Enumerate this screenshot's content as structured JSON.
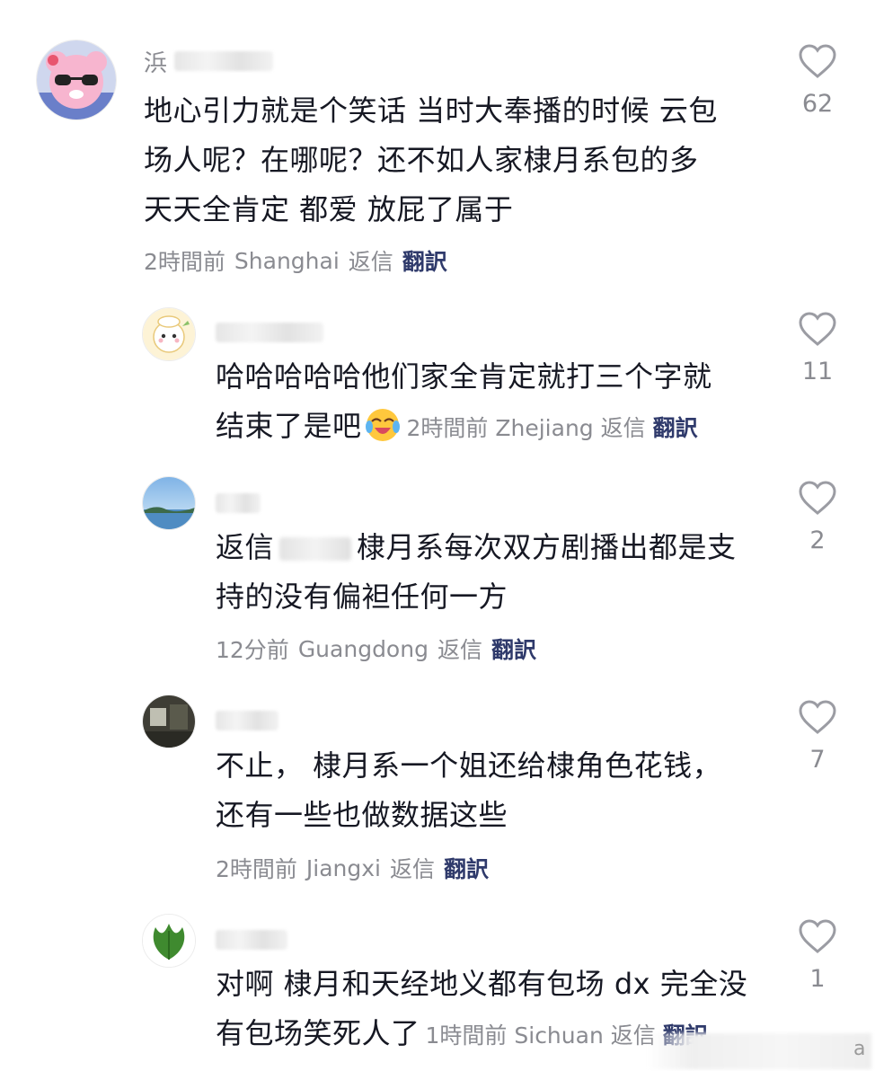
{
  "comments": [
    {
      "username": "浜",
      "text_lines": [
        "地心引力就是个笑话 当时大奉播的时候 云包",
        "场人呢？在哪呢？还不如人家棣月系包的多",
        "天天全肯定 都爱 放屁了属于"
      ],
      "time": "2時間前",
      "location": "Shanghai",
      "reply_label": "返信",
      "translate_label": "翻訳",
      "likes": "62"
    },
    {
      "text_lines": [
        "哈哈哈哈哈他们家全肯定就打三个字就",
        "结束了是吧"
      ],
      "time": "2時間前",
      "location": "Zhejiang",
      "reply_label": "返信",
      "translate_label": "翻訳",
      "likes": "11",
      "emoji": "crying-laughing-emoji"
    },
    {
      "reply_prefix": "返信",
      "text_lines": [
        "棣月系每次双方剧播出都是支",
        "持的没有偏袒任何一方"
      ],
      "time": "12分前",
      "location": "Guangdong",
      "reply_label": "返信",
      "translate_label": "翻訳",
      "likes": "2"
    },
    {
      "text_lines": [
        "不止， 棣月系一个姐还给棣角色花钱，",
        "还有一些也做数据这些"
      ],
      "time": "2時間前",
      "location": "Jiangxi",
      "reply_label": "返信",
      "translate_label": "翻訳",
      "likes": "7"
    },
    {
      "text_lines": [
        "对啊 棣月和天经地义都有包场 dx 完全没",
        "有包场笑死人了"
      ],
      "time": "1時間前",
      "location": "Sichuan",
      "reply_label": "返信",
      "translate_label": "翻訳",
      "likes": "1"
    }
  ],
  "watermark_letter": "a",
  "colors": {
    "text": "#161823",
    "meta": "#8a8b91",
    "translate": "#2f3a6b",
    "like_icon": "#9b9ca3"
  }
}
